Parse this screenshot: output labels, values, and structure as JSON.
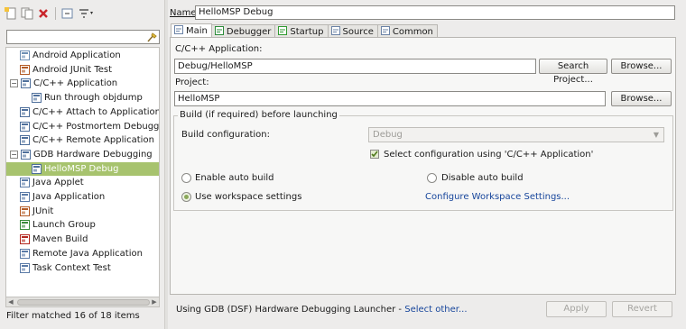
{
  "toolbar": {
    "icons": [
      "new-configuration-icon",
      "duplicate-icon",
      "delete-icon",
      "collapse-all-icon",
      "filter-icon"
    ]
  },
  "filter": {
    "value": "",
    "placeholder": ""
  },
  "tree": {
    "items": [
      {
        "label": "Android Application",
        "icon": "android-app-icon",
        "level": 1
      },
      {
        "label": "Android JUnit Test",
        "icon": "junit-icon",
        "level": 1
      },
      {
        "label": "C/C++ Application",
        "icon": "c-app-icon",
        "level": 0,
        "expanded": true
      },
      {
        "label": "Run through objdump",
        "icon": "c-app-icon",
        "level": 2
      },
      {
        "label": "C/C++ Attach to Application",
        "icon": "c-attach-icon",
        "level": 1
      },
      {
        "label": "C/C++ Postmortem Debugger",
        "icon": "c-postmortem-icon",
        "level": 1
      },
      {
        "label": "C/C++ Remote Application",
        "icon": "c-remote-icon",
        "level": 1
      },
      {
        "label": "GDB Hardware Debugging",
        "icon": "c-hw-icon",
        "level": 0,
        "expanded": true
      },
      {
        "label": "HelloMSP Debug",
        "icon": "c-hw-icon",
        "level": 2,
        "selected": true
      },
      {
        "label": "Java Applet",
        "icon": "java-applet-icon",
        "level": 1
      },
      {
        "label": "Java Application",
        "icon": "java-app-icon",
        "level": 1
      },
      {
        "label": "JUnit",
        "icon": "junit-icon",
        "level": 1
      },
      {
        "label": "Launch Group",
        "icon": "launch-group-icon",
        "level": 1
      },
      {
        "label": "Maven Build",
        "icon": "maven-icon",
        "level": 1
      },
      {
        "label": "Remote Java Application",
        "icon": "remote-java-icon",
        "level": 1
      },
      {
        "label": "Task Context Test",
        "icon": "task-context-icon",
        "level": 1
      }
    ]
  },
  "status_left": "Filter matched 16 of 18 items",
  "name": {
    "label": "Name:",
    "value": "HelloMSP Debug"
  },
  "tabs": [
    {
      "label": "Main",
      "icon": "main-tab-icon",
      "active": true
    },
    {
      "label": "Debugger",
      "icon": "debugger-tab-icon"
    },
    {
      "label": "Startup",
      "icon": "startup-tab-icon"
    },
    {
      "label": "Source",
      "icon": "source-tab-icon"
    },
    {
      "label": "Common",
      "icon": "common-tab-icon"
    }
  ],
  "main": {
    "app_label": "C/C++ Application:",
    "app_value": "Debug/HelloMSP",
    "search_project_btn": "Search Project...",
    "browse_btn": "Browse...",
    "project_label": "Project:",
    "project_value": "HelloMSP",
    "browse_btn2": "Browse...",
    "build_group_title": "Build (if required) before launching",
    "build_config_label": "Build configuration:",
    "build_config_value": "Debug",
    "select_config_label": "Select configuration using 'C/C++ Application'",
    "enable_auto_build": "Enable auto build",
    "disable_auto_build": "Disable auto build",
    "use_workspace": "Use workspace settings",
    "configure_workspace": "Configure Workspace Settings..."
  },
  "footer": {
    "launcher_text": "Using GDB (DSF) Hardware Debugging Launcher - ",
    "select_other": "Select other...",
    "apply": "Apply",
    "revert": "Revert"
  },
  "colors": {
    "selection": "#a7c36e",
    "link": "#16459b",
    "window_bg": "#edeceb"
  }
}
